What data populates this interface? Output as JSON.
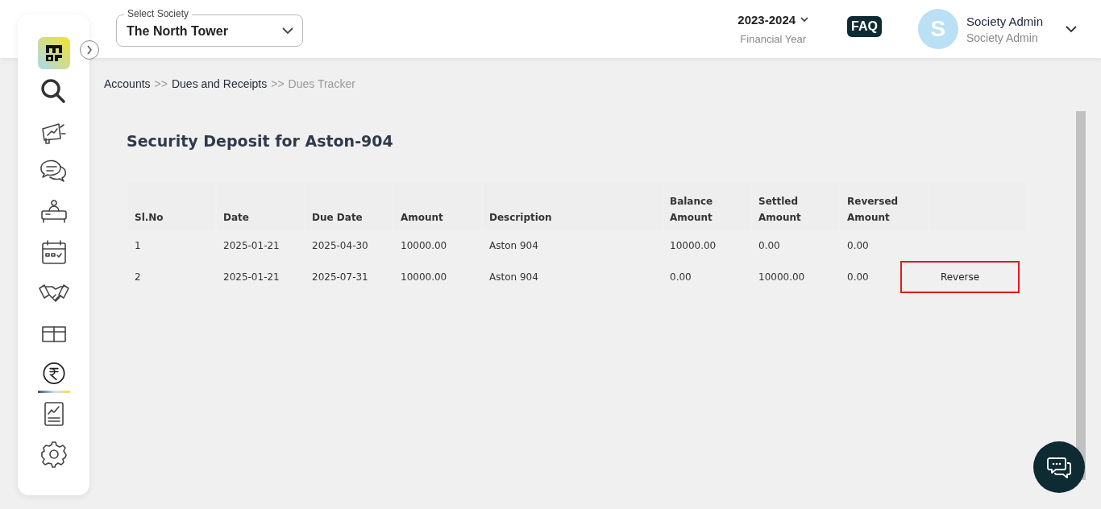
{
  "header": {
    "society_select": {
      "label": "Select Society",
      "value": "The North Tower"
    },
    "year": {
      "value": "2023-2024",
      "caption": "Financial Year"
    },
    "faq": "FAQ",
    "user": {
      "initial": "S",
      "name": "Society Admin",
      "role": "Society Admin"
    }
  },
  "sidebar": {
    "items": [
      {
        "selected": false
      },
      {
        "selected": false
      },
      {
        "selected": false
      },
      {
        "selected": false
      },
      {
        "selected": false
      },
      {
        "selected": false
      },
      {
        "selected": false
      },
      {
        "selected": true
      },
      {
        "selected": false
      },
      {
        "selected": false
      }
    ]
  },
  "breadcrumb": [
    {
      "label": "Accounts",
      "current": false
    },
    {
      "label": "Dues and Receipts",
      "current": false
    },
    {
      "label": "Dues Tracker",
      "current": true
    }
  ],
  "breadcrumb_separator": ">>",
  "title": "Security Deposit for Aston-904",
  "table": {
    "columns": [
      "Sl.No",
      "Date",
      "Due Date",
      "Amount",
      "Description",
      "Balance Amount",
      "Settled Amount",
      "Reversed Amount"
    ],
    "rows": [
      {
        "cells": [
          "1",
          "2025-01-21",
          "2025-04-30",
          "10000.00",
          "Aston 904",
          "10000.00",
          "0.00",
          "0.00"
        ]
      },
      {
        "cells": [
          "2",
          "2025-01-21",
          "2025-07-31",
          "10000.00",
          "Aston 904",
          "0.00",
          "10000.00",
          "0.00"
        ],
        "action": "Reverse",
        "highlighted": true
      }
    ]
  }
}
